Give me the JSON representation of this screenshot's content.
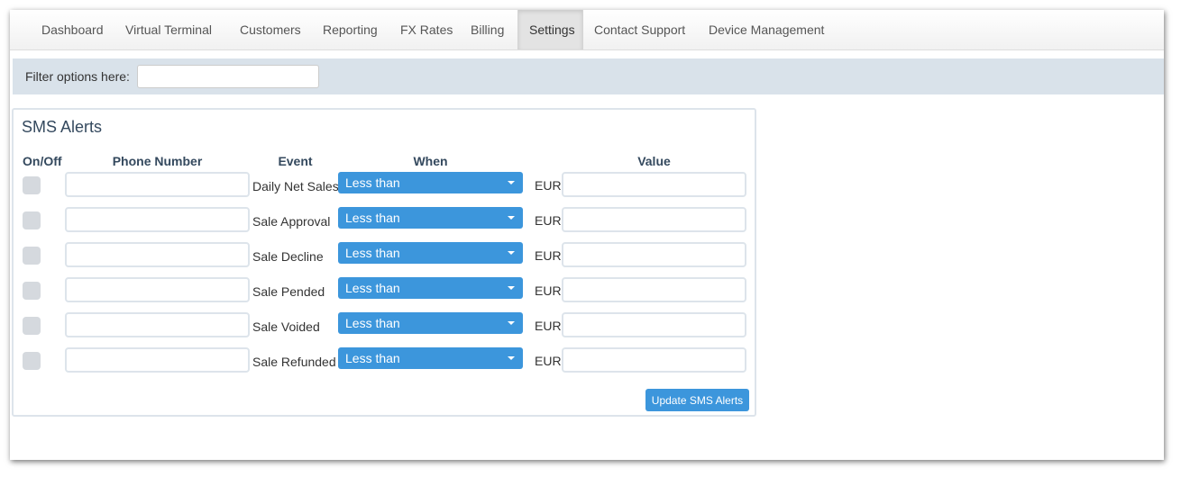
{
  "nav": {
    "items": [
      {
        "label": "Dashboard",
        "active": false
      },
      {
        "label": "Virtual Terminal",
        "active": false
      },
      {
        "label": "Customers",
        "active": false
      },
      {
        "label": "Reporting",
        "active": false
      },
      {
        "label": "FX Rates",
        "active": false
      },
      {
        "label": "Billing",
        "active": false
      },
      {
        "label": "Settings",
        "active": true
      },
      {
        "label": "Contact Support",
        "active": false
      },
      {
        "label": "Device Management",
        "active": false
      }
    ]
  },
  "filter": {
    "label": "Filter options here:",
    "value": ""
  },
  "sms_alerts": {
    "title": "SMS Alerts",
    "columns": {
      "on_off": "On/Off",
      "phone": "Phone Number",
      "event": "Event",
      "when": "When",
      "value": "Value"
    },
    "rows": [
      {
        "event": "Daily Net Sales",
        "when": "Less than",
        "currency": "EUR",
        "phone": "",
        "value": "",
        "enabled": false
      },
      {
        "event": "Sale Approval",
        "when": "Less than",
        "currency": "EUR",
        "phone": "",
        "value": "",
        "enabled": false
      },
      {
        "event": "Sale Decline",
        "when": "Less than",
        "currency": "EUR",
        "phone": "",
        "value": "",
        "enabled": false
      },
      {
        "event": "Sale Pended",
        "when": "Less than",
        "currency": "EUR",
        "phone": "",
        "value": "",
        "enabled": false
      },
      {
        "event": "Sale Voided",
        "when": "Less than",
        "currency": "EUR",
        "phone": "",
        "value": "",
        "enabled": false
      },
      {
        "event": "Sale Refunded",
        "when": "Less than",
        "currency": "EUR",
        "phone": "",
        "value": "",
        "enabled": false
      }
    ],
    "update_label": "Update SMS Alerts"
  },
  "colors": {
    "accent": "#3c96dc",
    "filter_bar": "#d9e2ea",
    "panel_border": "#dde4eb",
    "heading": "#34495e"
  },
  "icons": {
    "select_caret": "caret-down-icon"
  }
}
